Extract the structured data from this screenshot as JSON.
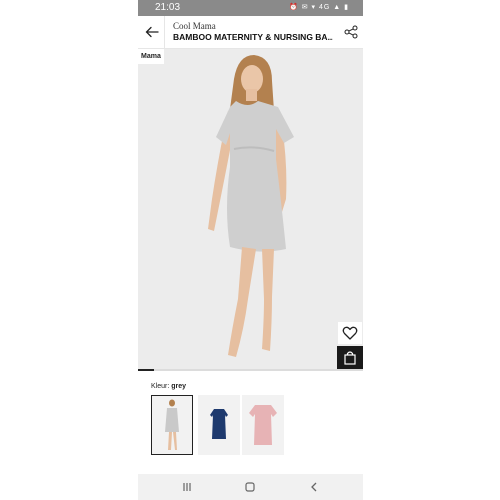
{
  "status_bar": {
    "time": "21:03",
    "icons": "⏰ ✉ ▾ 4G ▲ ▮"
  },
  "header": {
    "brand": "Cool Mama",
    "title": "BAMBOO MATERNITY & NURSING  BA..."
  },
  "product": {
    "badge": "Mama",
    "image_progress": 0.07,
    "color_label": "Kleur:",
    "color_value": "grey",
    "variants": [
      "grey",
      "navy",
      "pink"
    ],
    "selected_variant": "grey"
  },
  "colors": {
    "grey": "#c9c9c9",
    "navy": "#1e3a6e",
    "pink": "#e7b3b5",
    "accent": "#1a1a1a"
  },
  "icons": {
    "back": "arrow-left-icon",
    "share": "share-icon",
    "favorite": "heart-icon",
    "cart": "shopping-bag-icon",
    "nav_recents": "recents-icon",
    "nav_home": "home-icon",
    "nav_back": "nav-back-icon"
  }
}
